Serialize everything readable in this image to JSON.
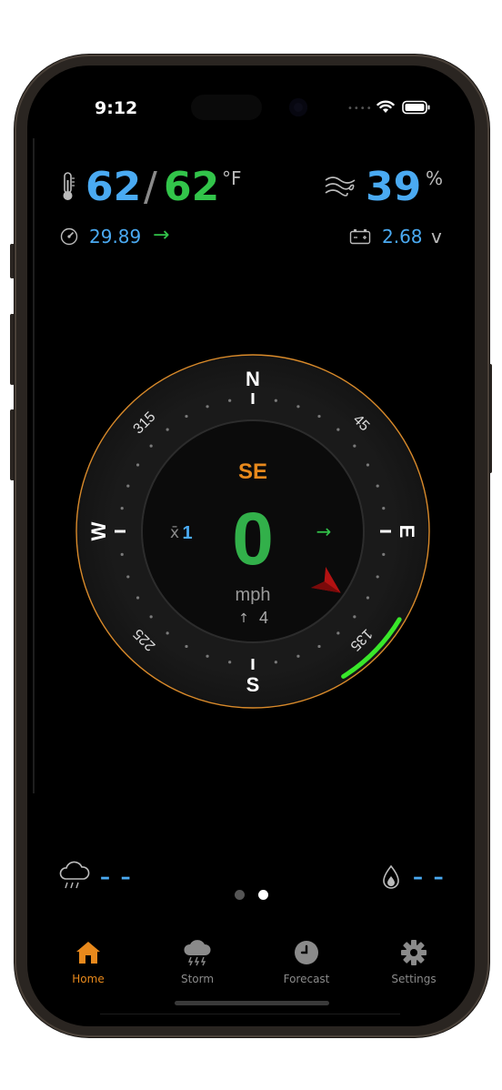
{
  "status": {
    "time": "9:12"
  },
  "weather": {
    "temp_actual": "62",
    "temp_separator": "/",
    "temp_feels": "62",
    "temp_unit": "°F",
    "humidity": "39",
    "humidity_unit": "%",
    "pressure": "29.89",
    "pressure_trend": "→",
    "battery": "2.68",
    "battery_unit": "v"
  },
  "compass": {
    "direction": "SE",
    "speed": "0",
    "speed_unit": "mph",
    "avg_label": "x̄",
    "avg_value": "1",
    "gust_arrow": "↑",
    "gust_value": "4",
    "trend_arrow": "→",
    "cardinals": {
      "n": "N",
      "e": "E",
      "s": "S",
      "w": "W"
    },
    "degrees": {
      "d45": "45",
      "d135": "135",
      "d225": "225",
      "d315": "315"
    },
    "colors": {
      "accent": "#e8891c",
      "ring": "#d98a2a",
      "gust_arc": "#39e82a",
      "needle": "#b31212"
    }
  },
  "bottom": {
    "rain_value": "– –",
    "dew_value": "– –",
    "page_count": 2,
    "active_page": 2
  },
  "tabs": [
    {
      "label": "Home",
      "icon": "house-icon",
      "active": true
    },
    {
      "label": "Storm",
      "icon": "storm-cloud-icon",
      "active": false
    },
    {
      "label": "Forecast",
      "icon": "clock-icon",
      "active": false
    },
    {
      "label": "Settings",
      "icon": "gear-icon",
      "active": false
    }
  ]
}
